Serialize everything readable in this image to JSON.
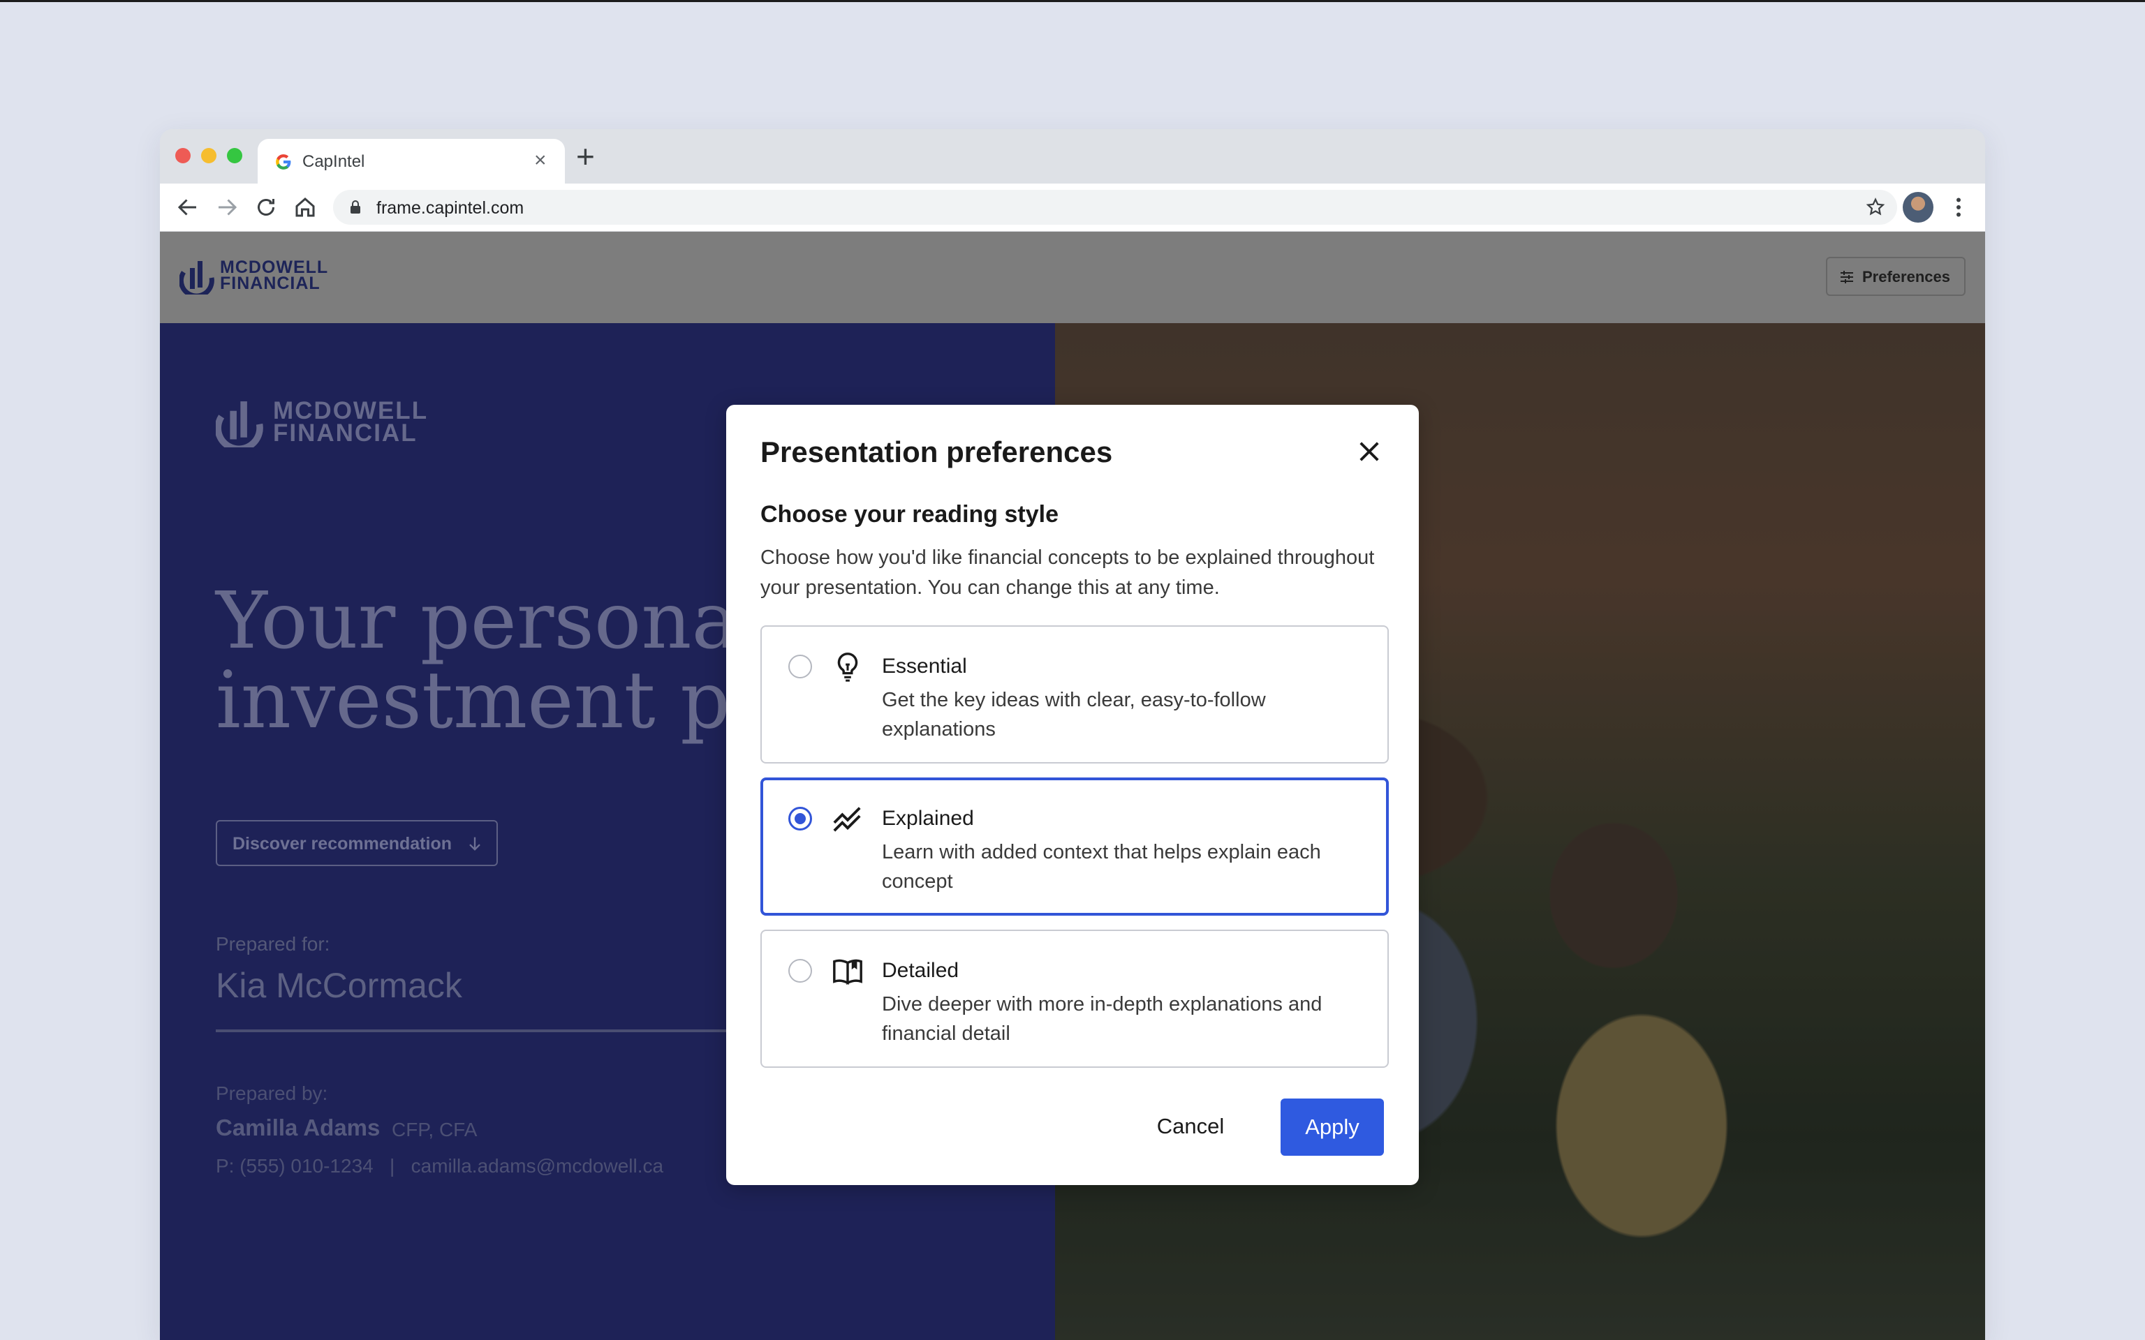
{
  "browser": {
    "tab_title": "CapIntel",
    "tab_close": "×",
    "new_tab": "+",
    "url": "frame.capintel.com"
  },
  "app": {
    "brand_line1": "MCDOWELL",
    "brand_line2": "FINANCIAL",
    "preferences_label": "Preferences"
  },
  "presentation": {
    "hero_line1": "Your personal",
    "hero_line2": "investment pr",
    "discover_label": "Discover recommendation",
    "prepared_for_label": "Prepared for:",
    "client_name": "Kia McCormack",
    "prepared_by_label": "Prepared by:",
    "advisor_name": "Camilla Adams",
    "advisor_credentials": "CFP, CFA",
    "contact_line": "P: (555) 010-1234   |   camilla.adams@mcdowell.ca"
  },
  "modal": {
    "title": "Presentation preferences",
    "subheading": "Choose your reading style",
    "description": "Choose how you'd like financial concepts to be explained throughout your presentation. You can change this at any time.",
    "options": [
      {
        "title": "Essential",
        "description": "Get the key ideas with clear, easy-to-follow explanations",
        "icon": "lightbulb-icon",
        "selected": false
      },
      {
        "title": "Explained",
        "description": "Learn with added context that helps explain each concept",
        "icon": "trend-chart-icon",
        "selected": true
      },
      {
        "title": "Detailed",
        "description": "Dive deeper with more in-depth explanations and financial detail",
        "icon": "open-book-icon",
        "selected": false
      }
    ],
    "cancel_label": "Cancel",
    "apply_label": "Apply"
  },
  "colors": {
    "accent": "#2f5ae0",
    "panel_navy": "#1e2257",
    "overlay_gray": "#7d7d7d"
  }
}
